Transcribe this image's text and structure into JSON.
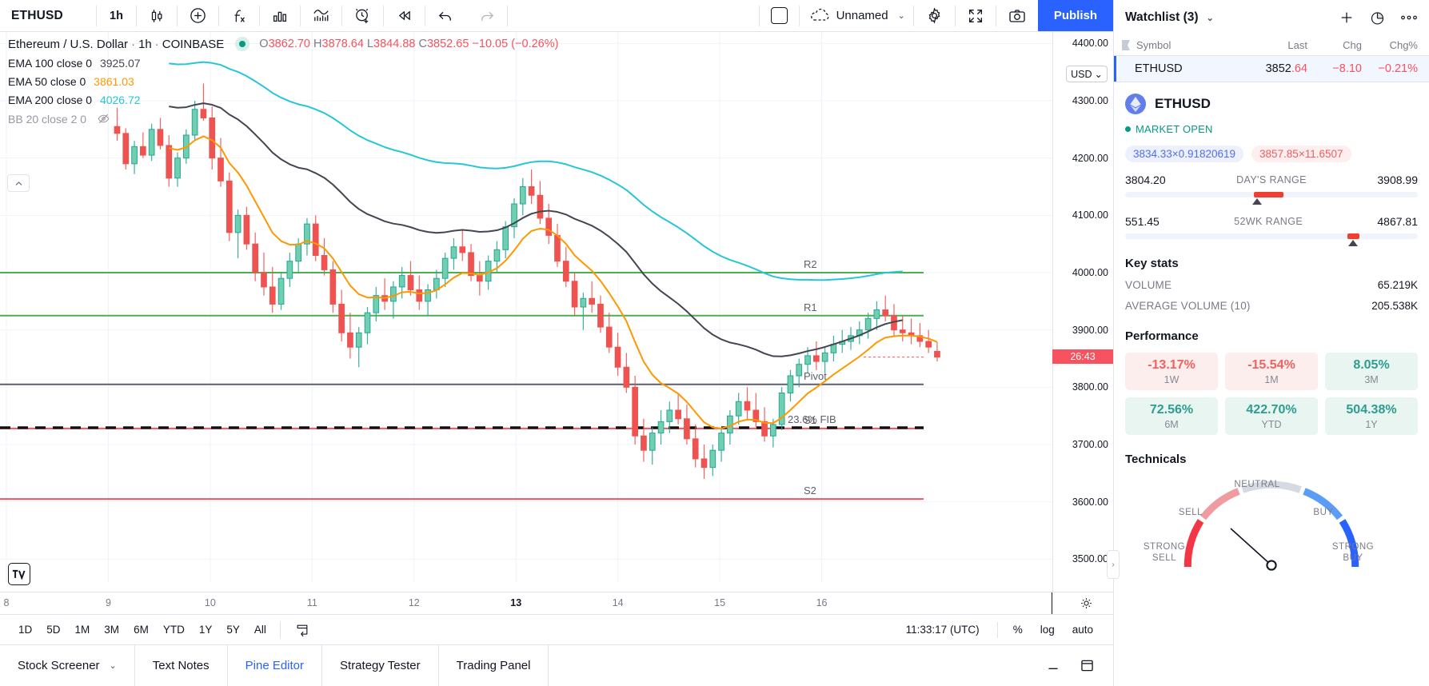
{
  "toolbar": {
    "symbol": "ETHUSD",
    "interval": "1h",
    "icons": [
      "candle-style-icon",
      "indicators-add-icon",
      "pine-function-icon",
      "bar-replay-stats-icon",
      "indicator-template-icon",
      "alert-add-icon",
      "replay-icon",
      "undo-icon",
      "redo-icon"
    ],
    "layout_label": "",
    "layout_name": "Unnamed",
    "chevron": "⌄",
    "publish": "Publish"
  },
  "chart": {
    "legend_title": "Ethereum / U.S. Dollar",
    "interval": "1h",
    "exchange": "COINBASE",
    "ohlc": {
      "o_key": "O",
      "o": "3862.70",
      "h_key": "H",
      "h": "3878.64",
      "l_key": "L",
      "l": "3844.88",
      "c_key": "C",
      "c": "3852.65",
      "change": "−10.05",
      "change_pct": "(−0.26%)"
    },
    "studies": [
      {
        "name": "EMA 100 close 0",
        "value": "3925.07",
        "color": "#434651"
      },
      {
        "name": "EMA 50 close 0",
        "value": "3861.03",
        "color": "#ff9800"
      },
      {
        "name": "EMA 200 close 0",
        "value": "4026.72",
        "color": "#26c6da"
      },
      {
        "name": "BB 20 close 2 0",
        "value": "",
        "color": "#9598a1"
      }
    ],
    "current_price_badge": "26:43",
    "currency_button": "USD",
    "price_labels": [
      "4400.00",
      "4300.00",
      "4200.00",
      "4100.00",
      "4000.00",
      "3900.00",
      "3800.00",
      "3700.00",
      "3600.00",
      "3500.00"
    ],
    "time_labels": [
      "8",
      "9",
      "10",
      "11",
      "12",
      "13",
      "14",
      "15",
      "16"
    ],
    "levels": [
      {
        "label": "R2",
        "color": "#4caf50"
      },
      {
        "label": "R1",
        "color": "#4caf50"
      },
      {
        "label": "Pivot",
        "color": "#5d606b"
      },
      {
        "label": "23.6% FIB",
        "color": "#111111"
      },
      {
        "label": "S1",
        "color": "#f7525f"
      },
      {
        "label": "S2",
        "color": "#f7525f"
      }
    ]
  },
  "chart_data": {
    "type": "candlestick",
    "title": "Ethereum / U.S. Dollar · 1h · COINBASE",
    "xlabel": "",
    "ylabel": "USD",
    "ylim": [
      3460,
      4420
    ],
    "xtick_labels": [
      "8",
      "9",
      "10",
      "11",
      "12",
      "13",
      "14",
      "15",
      "16"
    ],
    "ytick_labels": [
      "4400.00",
      "4300.00",
      "4200.00",
      "4100.00",
      "4000.00",
      "3900.00",
      "3800.00",
      "3700.00",
      "3600.00",
      "3500.00"
    ],
    "up_color": "#26a69a",
    "down_color": "#ef5350",
    "last_price": 3852.65,
    "ohlc_latest": {
      "open": 3862.7,
      "high": 3878.64,
      "low": 3844.88,
      "close": 3852.65
    },
    "levels": {
      "R2": 4000,
      "R1": 3925,
      "Pivot": 3805,
      "FIB_23_6": 3735,
      "S1": 3728,
      "S2": 3605
    },
    "series": [
      {
        "name": "EMA 100",
        "color": "#434651",
        "last": 3925.07
      },
      {
        "name": "EMA 50",
        "color": "#ff9800",
        "last": 3861.03
      },
      {
        "name": "EMA 200",
        "color": "#26c6da",
        "last": 4026.72
      }
    ],
    "candles": [
      [
        4255,
        4288,
        4230,
        4243
      ],
      [
        4243,
        4252,
        4180,
        4190
      ],
      [
        4190,
        4230,
        4172,
        4220
      ],
      [
        4220,
        4245,
        4200,
        4205
      ],
      [
        4205,
        4260,
        4195,
        4250
      ],
      [
        4250,
        4270,
        4215,
        4222
      ],
      [
        4222,
        4240,
        4150,
        4165
      ],
      [
        4165,
        4210,
        4150,
        4200
      ],
      [
        4200,
        4250,
        4190,
        4240
      ],
      [
        4240,
        4300,
        4230,
        4285
      ],
      [
        4285,
        4330,
        4265,
        4270
      ],
      [
        4270,
        4290,
        4180,
        4200
      ],
      [
        4200,
        4235,
        4150,
        4160
      ],
      [
        4160,
        4175,
        4055,
        4070
      ],
      [
        4070,
        4110,
        4025,
        4100
      ],
      [
        4100,
        4115,
        4040,
        4050
      ],
      [
        4050,
        4070,
        3985,
        4000
      ],
      [
        4000,
        4035,
        3960,
        3975
      ],
      [
        3975,
        4010,
        3930,
        3945
      ],
      [
        3945,
        4000,
        3935,
        3990
      ],
      [
        3990,
        4035,
        3975,
        4020
      ],
      [
        4020,
        4060,
        4000,
        4050
      ],
      [
        4050,
        4095,
        4030,
        4085
      ],
      [
        4085,
        4100,
        4020,
        4030
      ],
      [
        4030,
        4060,
        3995,
        4005
      ],
      [
        4005,
        4020,
        3930,
        3945
      ],
      [
        3945,
        3970,
        3880,
        3895
      ],
      [
        3895,
        3930,
        3850,
        3870
      ],
      [
        3870,
        3905,
        3835,
        3895
      ],
      [
        3895,
        3940,
        3875,
        3930
      ],
      [
        3930,
        3975,
        3915,
        3960
      ],
      [
        3960,
        3990,
        3935,
        3950
      ],
      [
        3950,
        3985,
        3920,
        3975
      ],
      [
        3975,
        4010,
        3955,
        3995
      ],
      [
        3995,
        4020,
        3960,
        3970
      ],
      [
        3970,
        3995,
        3935,
        3950
      ],
      [
        3950,
        3980,
        3925,
        3970
      ],
      [
        3970,
        4005,
        3955,
        3990
      ],
      [
        3990,
        4035,
        3975,
        4025
      ],
      [
        4025,
        4060,
        4005,
        4045
      ],
      [
        4045,
        4075,
        4020,
        4035
      ],
      [
        4035,
        4050,
        3985,
        3995
      ],
      [
        3995,
        4020,
        3960,
        3985
      ],
      [
        3985,
        4030,
        3970,
        4020
      ],
      [
        4020,
        4055,
        4000,
        4040
      ],
      [
        4040,
        4090,
        4025,
        4080
      ],
      [
        4080,
        4130,
        4060,
        4120
      ],
      [
        4120,
        4165,
        4100,
        4150
      ],
      [
        4150,
        4180,
        4120,
        4135
      ],
      [
        4135,
        4160,
        4085,
        4095
      ],
      [
        4095,
        4120,
        4050,
        4065
      ],
      [
        4065,
        4085,
        4010,
        4020
      ],
      [
        4020,
        4045,
        3975,
        3985
      ],
      [
        3985,
        4000,
        3925,
        3940
      ],
      [
        3940,
        3965,
        3900,
        3955
      ],
      [
        3955,
        3985,
        3930,
        3945
      ],
      [
        3945,
        3960,
        3895,
        3905
      ],
      [
        3905,
        3930,
        3860,
        3870
      ],
      [
        3870,
        3895,
        3820,
        3835
      ],
      [
        3835,
        3860,
        3790,
        3800
      ],
      [
        3800,
        3820,
        3700,
        3715
      ],
      [
        3715,
        3745,
        3670,
        3690
      ],
      [
        3690,
        3730,
        3665,
        3720
      ],
      [
        3720,
        3760,
        3700,
        3740
      ],
      [
        3740,
        3775,
        3720,
        3760
      ],
      [
        3760,
        3790,
        3735,
        3745
      ],
      [
        3745,
        3770,
        3700,
        3710
      ],
      [
        3710,
        3735,
        3660,
        3675
      ],
      [
        3675,
        3700,
        3640,
        3660
      ],
      [
        3660,
        3700,
        3645,
        3690
      ],
      [
        3690,
        3730,
        3670,
        3720
      ],
      [
        3720,
        3760,
        3700,
        3750
      ],
      [
        3750,
        3790,
        3735,
        3775
      ],
      [
        3775,
        3800,
        3745,
        3760
      ],
      [
        3760,
        3790,
        3730,
        3740
      ],
      [
        3740,
        3765,
        3705,
        3715
      ],
      [
        3715,
        3745,
        3695,
        3735
      ],
      [
        3735,
        3800,
        3725,
        3790
      ],
      [
        3790,
        3830,
        3775,
        3820
      ],
      [
        3820,
        3850,
        3800,
        3840
      ],
      [
        3840,
        3870,
        3825,
        3855
      ],
      [
        3855,
        3880,
        3830,
        3845
      ],
      [
        3845,
        3870,
        3825,
        3860
      ],
      [
        3860,
        3890,
        3845,
        3875
      ],
      [
        3875,
        3900,
        3860,
        3880
      ],
      [
        3880,
        3905,
        3865,
        3890
      ],
      [
        3890,
        3915,
        3875,
        3900
      ],
      [
        3900,
        3930,
        3885,
        3920
      ],
      [
        3920,
        3950,
        3900,
        3935
      ],
      [
        3935,
        3960,
        3915,
        3925
      ],
      [
        3925,
        3945,
        3890,
        3900
      ],
      [
        3900,
        3925,
        3880,
        3895
      ],
      [
        3895,
        3920,
        3875,
        3890
      ],
      [
        3890,
        3912,
        3870,
        3880
      ],
      [
        3880,
        3900,
        3860,
        3870
      ],
      [
        3862.7,
        3878.64,
        3844.88,
        3852.65
      ]
    ]
  },
  "rangebar": {
    "items": [
      "1D",
      "5D",
      "1M",
      "3M",
      "6M",
      "YTD",
      "1Y",
      "5Y",
      "All"
    ],
    "calendar_icon": "date-range-icon",
    "clock": "11:33:17 (UTC)",
    "percent": "%",
    "log": "log",
    "auto": "auto"
  },
  "bottombar": {
    "tabs": [
      {
        "label": "Stock Screener",
        "active": false,
        "chevron": "⌄"
      },
      {
        "label": "Text Notes",
        "active": false,
        "chevron": ""
      },
      {
        "label": "Pine Editor",
        "active": true,
        "chevron": ""
      },
      {
        "label": "Strategy Tester",
        "active": false,
        "chevron": ""
      },
      {
        "label": "Trading Panel",
        "active": false,
        "chevron": ""
      }
    ],
    "minimize": "minimize-icon",
    "maximize": "panel-icon"
  },
  "watchlist": {
    "title": "Watchlist (3)",
    "chevron": "⌄",
    "add_icon": "plus-icon",
    "pie_icon": "pie-chart-icon",
    "more_icon": "more-options-icon",
    "columns": [
      "Symbol",
      "Last",
      "Chg",
      "Chg%"
    ],
    "rows": [
      {
        "symbol": "ETHUSD",
        "last": "3852.64",
        "last_int": "3852",
        "last_dec": ".64",
        "chg": "−8.10",
        "chgp": "−0.21%"
      }
    ]
  },
  "detail": {
    "symbol": "ETHUSD",
    "status": "MARKET OPEN",
    "bid": "3834.33×0.91820619",
    "ask": "3857.85×11.6507",
    "day_range": {
      "label": "DAY'S RANGE",
      "low": "3804.20",
      "high": "3908.99",
      "fill_left_pct": 44,
      "fill_width_pct": 10,
      "marker_pct": 45
    },
    "wk52_range": {
      "label": "52WK RANGE",
      "low": "551.45",
      "high": "4867.81",
      "fill_left_pct": 76,
      "fill_width_pct": 4,
      "marker_pct": 78
    },
    "keystats_title": "Key stats",
    "keystats": [
      {
        "label": "VOLUME",
        "value": "65.219K"
      },
      {
        "label": "AVERAGE VOLUME (10)",
        "value": "205.538K"
      }
    ],
    "performance_title": "Performance",
    "performance": [
      {
        "value": "-13.17%",
        "period": "1W",
        "sign": "neg"
      },
      {
        "value": "-15.54%",
        "period": "1M",
        "sign": "neg"
      },
      {
        "value": "8.05%",
        "period": "3M",
        "sign": "pos"
      },
      {
        "value": "72.56%",
        "period": "6M",
        "sign": "pos"
      },
      {
        "value": "422.70%",
        "period": "YTD",
        "sign": "pos"
      },
      {
        "value": "504.38%",
        "period": "1Y",
        "sign": "pos"
      }
    ],
    "technicals_title": "Technicals",
    "gauge": {
      "labels": {
        "strong_sell": "STRONG\nSELL",
        "sell": "SELL",
        "neutral": "NEUTRAL",
        "buy": "BUY",
        "strong_buy": "STRONG\nBUY"
      },
      "needle_angle_deg": -42,
      "rating": "sell"
    }
  }
}
